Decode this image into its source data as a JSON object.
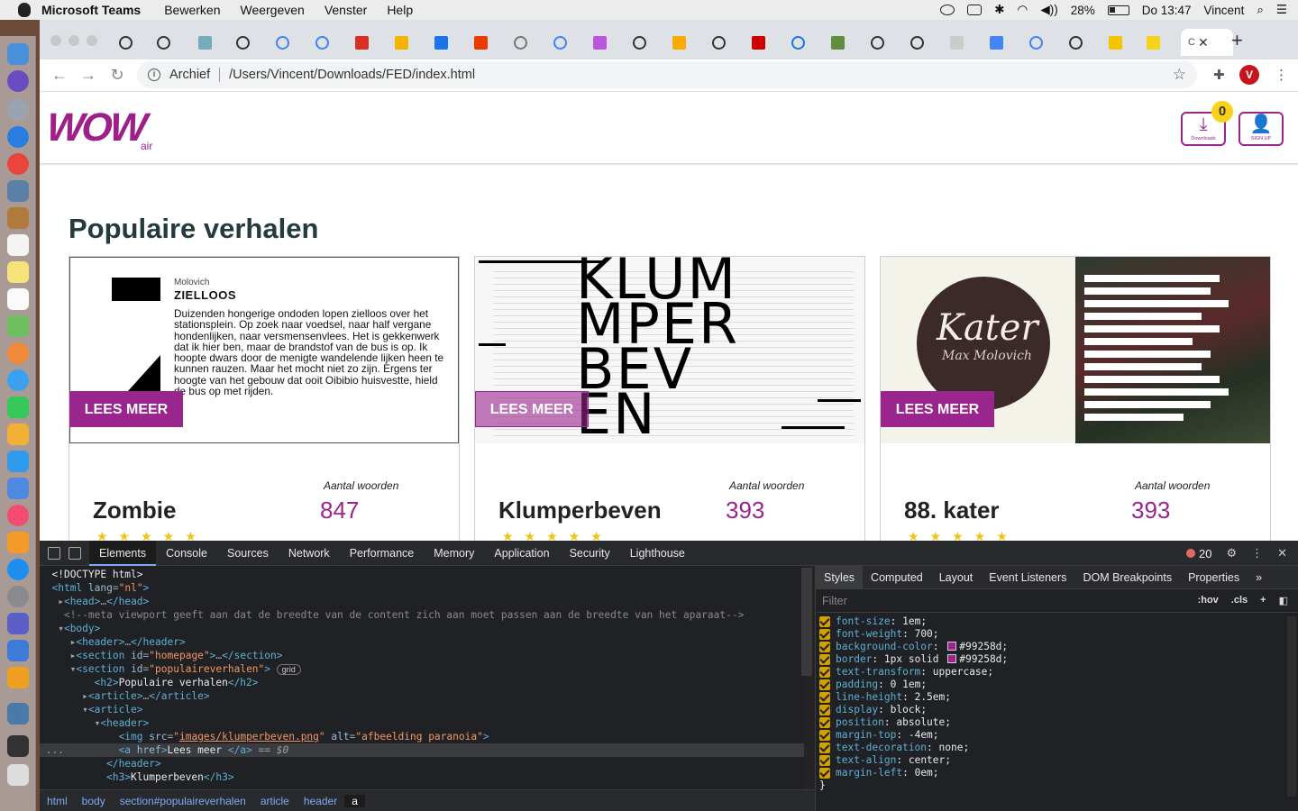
{
  "menubar": {
    "app": "Microsoft Teams",
    "items": [
      "Bewerken",
      "Weergeven",
      "Venster",
      "Help"
    ],
    "battery": "28%",
    "clock": "Do 13:47",
    "user": "Vincent"
  },
  "browser": {
    "address_prefix": "Archief",
    "url": "/Users/Vincent/Downloads/FED/index.html",
    "active_tab_label": "C",
    "avatar_letter": "V"
  },
  "site": {
    "logo": "WOW",
    "logo_sub": "air",
    "downloads_label": "Downloads",
    "downloads_count": "0",
    "signup_label": "SIGN UP",
    "section_title": "Populaire verhalen",
    "cards": [
      {
        "title": "Zombie",
        "word_label": "Aantal woorden",
        "word_count": "847",
        "button": "LEES MEER",
        "cover_author": "Molovich",
        "cover_title": "ZIELLOOS",
        "cover_text": "Duizenden hongerige ondoden lopen zielloos over het stationsplein. Op zoek naar voedsel, naar half vergane hondenlijken, naar versmensenvlees. Het is gekkenwerk dat ik hier ben, maar de brandstof van de bus is op. Ik hoopte dwars door de menigte wandelende lijken heen te kunnen rauzen. Maar het mocht niet zo zijn. Ergens ter hoogte van het gebouw dat ooit Oibibio huisvestte, hield de bus op met rijden."
      },
      {
        "title": "Klumperbeven",
        "word_label": "Aantal woorden",
        "word_count": "393",
        "button": "LEES MEER",
        "cover_text": "KLUM\nMPER\nBEV\nEN"
      },
      {
        "title": "88. kater",
        "word_label": "Aantal woorden",
        "word_count": "393",
        "button": "LEES MEER",
        "cover_title": "Kater",
        "cover_author": "Max Molovich"
      }
    ]
  },
  "devtools": {
    "tabs": [
      "Elements",
      "Console",
      "Sources",
      "Network",
      "Performance",
      "Memory",
      "Application",
      "Security",
      "Lighthouse"
    ],
    "active_tab": "Elements",
    "error_count": "20",
    "style_tabs": [
      "Styles",
      "Computed",
      "Layout",
      "Event Listeners",
      "DOM Breakpoints",
      "Properties"
    ],
    "filter_placeholder": "Filter",
    "hov": ":hov",
    "cls": ".cls",
    "breadcrumbs": [
      "html",
      "body",
      "section#populaireverhalen",
      "article",
      "header",
      "a"
    ],
    "css_rules": [
      {
        "prop": "font-size",
        "value": "1em;"
      },
      {
        "prop": "font-weight",
        "value": "700;"
      },
      {
        "prop": "background-color",
        "value": "#99258d;"
      },
      {
        "prop": "border",
        "value": "1px solid #99258d;"
      },
      {
        "prop": "text-transform",
        "value": "uppercase;"
      },
      {
        "prop": "padding",
        "value": "0 1em;"
      },
      {
        "prop": "line-height",
        "value": "2.5em;"
      },
      {
        "prop": "display",
        "value": "block;"
      },
      {
        "prop": "position",
        "value": "absolute;"
      },
      {
        "prop": "margin-top",
        "value": "-4em;"
      },
      {
        "prop": "text-decoration",
        "value": "none;"
      },
      {
        "prop": "text-align",
        "value": "center;"
      },
      {
        "prop": "margin-left",
        "value": "0em;"
      }
    ],
    "accent_color": "#99258d"
  }
}
